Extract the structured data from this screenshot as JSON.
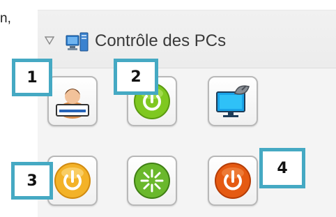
{
  "fragment_text": "n,",
  "panel": {
    "title": "Contrôle des PCs",
    "collapse_icon": "triangle-down-icon",
    "title_icon": "computers-icon"
  },
  "tiles": [
    {
      "name": "user-session-tile",
      "icon": "user-at-computer-icon"
    },
    {
      "name": "power-on-tile",
      "icon": "green-power-icon"
    },
    {
      "name": "remote-display-tile",
      "icon": "monitor-satellite-icon"
    },
    {
      "name": "standby-tile",
      "icon": "orange-power-icon"
    },
    {
      "name": "restart-tile",
      "icon": "green-starburst-icon"
    },
    {
      "name": "shutdown-tile",
      "icon": "red-power-icon"
    }
  ],
  "callouts": [
    "1",
    "2",
    "3",
    "4"
  ],
  "colors": {
    "callout_border": "#45a9c3",
    "power_green": "#7fc820",
    "power_orange": "#f3b228",
    "power_red": "#e55a12"
  }
}
